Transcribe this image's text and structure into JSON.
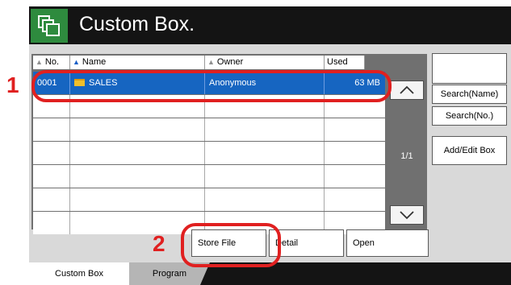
{
  "title": "Custom Box.",
  "columns": [
    {
      "label": "No.",
      "sort": "none"
    },
    {
      "label": "Name",
      "sort": "asc"
    },
    {
      "label": "Owner",
      "sort": "none"
    },
    {
      "label": "Used",
      "sort": "none"
    }
  ],
  "boxes": [
    {
      "no": "0001",
      "name": "SALES",
      "owner": "Anonymous",
      "used": "63 MB",
      "selected": true
    }
  ],
  "empty_rows": 6,
  "pager": {
    "page": "1/1"
  },
  "side_buttons": {
    "search_name": "Search(Name)",
    "search_no": "Search(No.)",
    "add_edit": "Add/Edit Box"
  },
  "actions": {
    "store_file": "Store File",
    "detail": "Detail",
    "open": "Open"
  },
  "tabs": {
    "custom_box": "Custom Box",
    "program": "Program"
  },
  "callouts": {
    "step1": "1",
    "step2": "2"
  },
  "colors": {
    "accent_blue": "#1665c1",
    "callout_red": "#e02020",
    "title_icon_green": "#2e8b3e"
  }
}
